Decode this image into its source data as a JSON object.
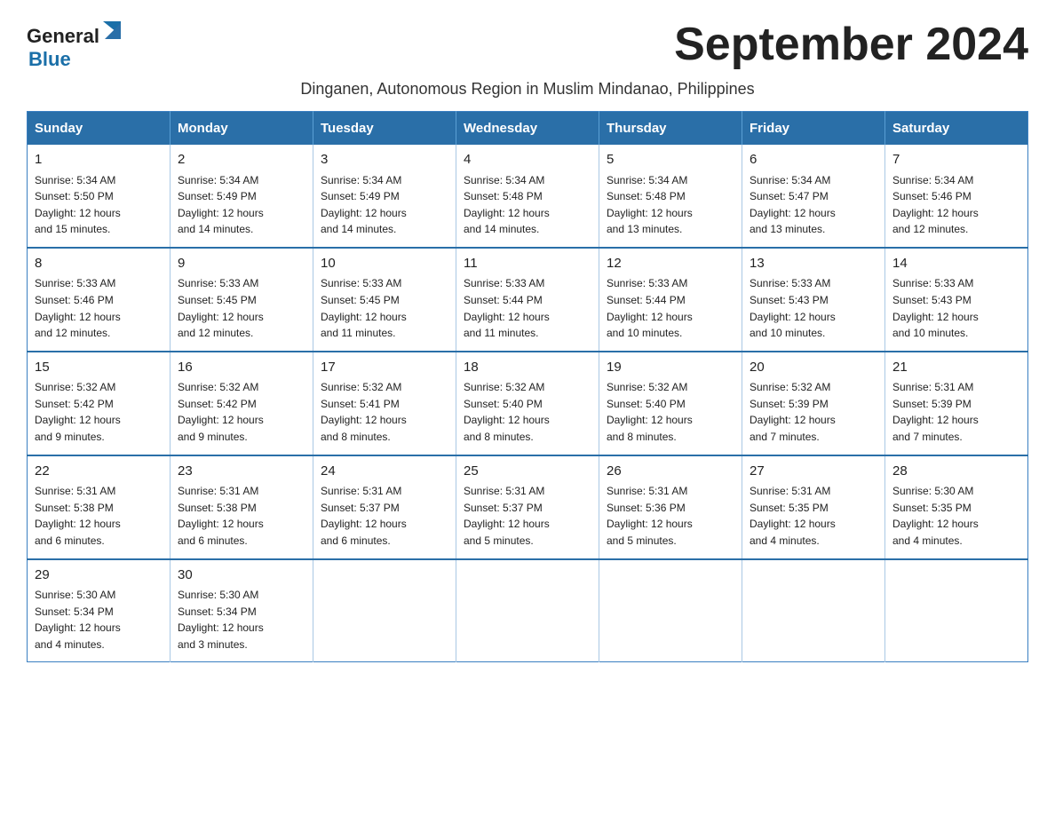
{
  "logo": {
    "text_general": "General",
    "text_blue": "Blue",
    "icon_shape": "triangle"
  },
  "title": "September 2024",
  "subtitle": "Dinganen, Autonomous Region in Muslim Mindanao, Philippines",
  "days_of_week": [
    "Sunday",
    "Monday",
    "Tuesday",
    "Wednesday",
    "Thursday",
    "Friday",
    "Saturday"
  ],
  "weeks": [
    [
      {
        "day": "1",
        "sunrise": "5:34 AM",
        "sunset": "5:50 PM",
        "daylight": "12 hours and 15 minutes."
      },
      {
        "day": "2",
        "sunrise": "5:34 AM",
        "sunset": "5:49 PM",
        "daylight": "12 hours and 14 minutes."
      },
      {
        "day": "3",
        "sunrise": "5:34 AM",
        "sunset": "5:49 PM",
        "daylight": "12 hours and 14 minutes."
      },
      {
        "day": "4",
        "sunrise": "5:34 AM",
        "sunset": "5:48 PM",
        "daylight": "12 hours and 14 minutes."
      },
      {
        "day": "5",
        "sunrise": "5:34 AM",
        "sunset": "5:48 PM",
        "daylight": "12 hours and 13 minutes."
      },
      {
        "day": "6",
        "sunrise": "5:34 AM",
        "sunset": "5:47 PM",
        "daylight": "12 hours and 13 minutes."
      },
      {
        "day": "7",
        "sunrise": "5:34 AM",
        "sunset": "5:46 PM",
        "daylight": "12 hours and 12 minutes."
      }
    ],
    [
      {
        "day": "8",
        "sunrise": "5:33 AM",
        "sunset": "5:46 PM",
        "daylight": "12 hours and 12 minutes."
      },
      {
        "day": "9",
        "sunrise": "5:33 AM",
        "sunset": "5:45 PM",
        "daylight": "12 hours and 12 minutes."
      },
      {
        "day": "10",
        "sunrise": "5:33 AM",
        "sunset": "5:45 PM",
        "daylight": "12 hours and 11 minutes."
      },
      {
        "day": "11",
        "sunrise": "5:33 AM",
        "sunset": "5:44 PM",
        "daylight": "12 hours and 11 minutes."
      },
      {
        "day": "12",
        "sunrise": "5:33 AM",
        "sunset": "5:44 PM",
        "daylight": "12 hours and 10 minutes."
      },
      {
        "day": "13",
        "sunrise": "5:33 AM",
        "sunset": "5:43 PM",
        "daylight": "12 hours and 10 minutes."
      },
      {
        "day": "14",
        "sunrise": "5:33 AM",
        "sunset": "5:43 PM",
        "daylight": "12 hours and 10 minutes."
      }
    ],
    [
      {
        "day": "15",
        "sunrise": "5:32 AM",
        "sunset": "5:42 PM",
        "daylight": "12 hours and 9 minutes."
      },
      {
        "day": "16",
        "sunrise": "5:32 AM",
        "sunset": "5:42 PM",
        "daylight": "12 hours and 9 minutes."
      },
      {
        "day": "17",
        "sunrise": "5:32 AM",
        "sunset": "5:41 PM",
        "daylight": "12 hours and 8 minutes."
      },
      {
        "day": "18",
        "sunrise": "5:32 AM",
        "sunset": "5:40 PM",
        "daylight": "12 hours and 8 minutes."
      },
      {
        "day": "19",
        "sunrise": "5:32 AM",
        "sunset": "5:40 PM",
        "daylight": "12 hours and 8 minutes."
      },
      {
        "day": "20",
        "sunrise": "5:32 AM",
        "sunset": "5:39 PM",
        "daylight": "12 hours and 7 minutes."
      },
      {
        "day": "21",
        "sunrise": "5:31 AM",
        "sunset": "5:39 PM",
        "daylight": "12 hours and 7 minutes."
      }
    ],
    [
      {
        "day": "22",
        "sunrise": "5:31 AM",
        "sunset": "5:38 PM",
        "daylight": "12 hours and 6 minutes."
      },
      {
        "day": "23",
        "sunrise": "5:31 AM",
        "sunset": "5:38 PM",
        "daylight": "12 hours and 6 minutes."
      },
      {
        "day": "24",
        "sunrise": "5:31 AM",
        "sunset": "5:37 PM",
        "daylight": "12 hours and 6 minutes."
      },
      {
        "day": "25",
        "sunrise": "5:31 AM",
        "sunset": "5:37 PM",
        "daylight": "12 hours and 5 minutes."
      },
      {
        "day": "26",
        "sunrise": "5:31 AM",
        "sunset": "5:36 PM",
        "daylight": "12 hours and 5 minutes."
      },
      {
        "day": "27",
        "sunrise": "5:31 AM",
        "sunset": "5:35 PM",
        "daylight": "12 hours and 4 minutes."
      },
      {
        "day": "28",
        "sunrise": "5:30 AM",
        "sunset": "5:35 PM",
        "daylight": "12 hours and 4 minutes."
      }
    ],
    [
      {
        "day": "29",
        "sunrise": "5:30 AM",
        "sunset": "5:34 PM",
        "daylight": "12 hours and 4 minutes."
      },
      {
        "day": "30",
        "sunrise": "5:30 AM",
        "sunset": "5:34 PM",
        "daylight": "12 hours and 3 minutes."
      },
      null,
      null,
      null,
      null,
      null
    ]
  ],
  "labels": {
    "sunrise": "Sunrise:",
    "sunset": "Sunset:",
    "daylight": "Daylight:"
  },
  "colors": {
    "header_bg": "#2a6fa8",
    "border": "#3a7fc1"
  }
}
